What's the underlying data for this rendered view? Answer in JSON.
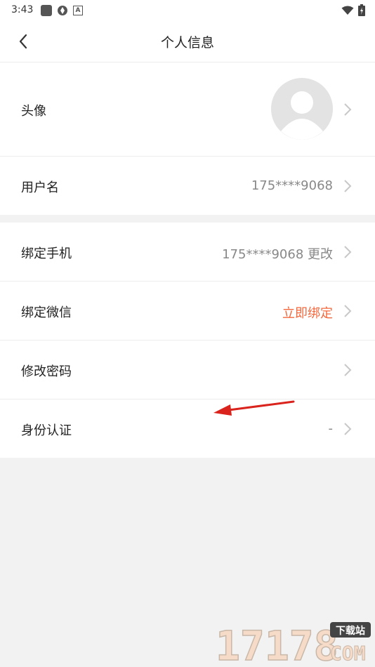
{
  "status": {
    "time": "3:43"
  },
  "header": {
    "title": "个人信息"
  },
  "profile": {
    "avatar_label": "头像",
    "username_label": "用户名",
    "username_value": "175****9068"
  },
  "account": {
    "items": [
      {
        "label": "绑定手机",
        "value": "175****9068 更改"
      },
      {
        "label": "绑定微信",
        "value": "立即绑定"
      },
      {
        "label": "修改密码",
        "value": ""
      },
      {
        "label": "身份认证",
        "value": "-"
      }
    ]
  },
  "colors": {
    "accent": "#f4683d",
    "background": "#f2f2f2"
  },
  "watermark": {
    "numbers": "17178",
    "tag": "下载站",
    "domain": "COM"
  }
}
